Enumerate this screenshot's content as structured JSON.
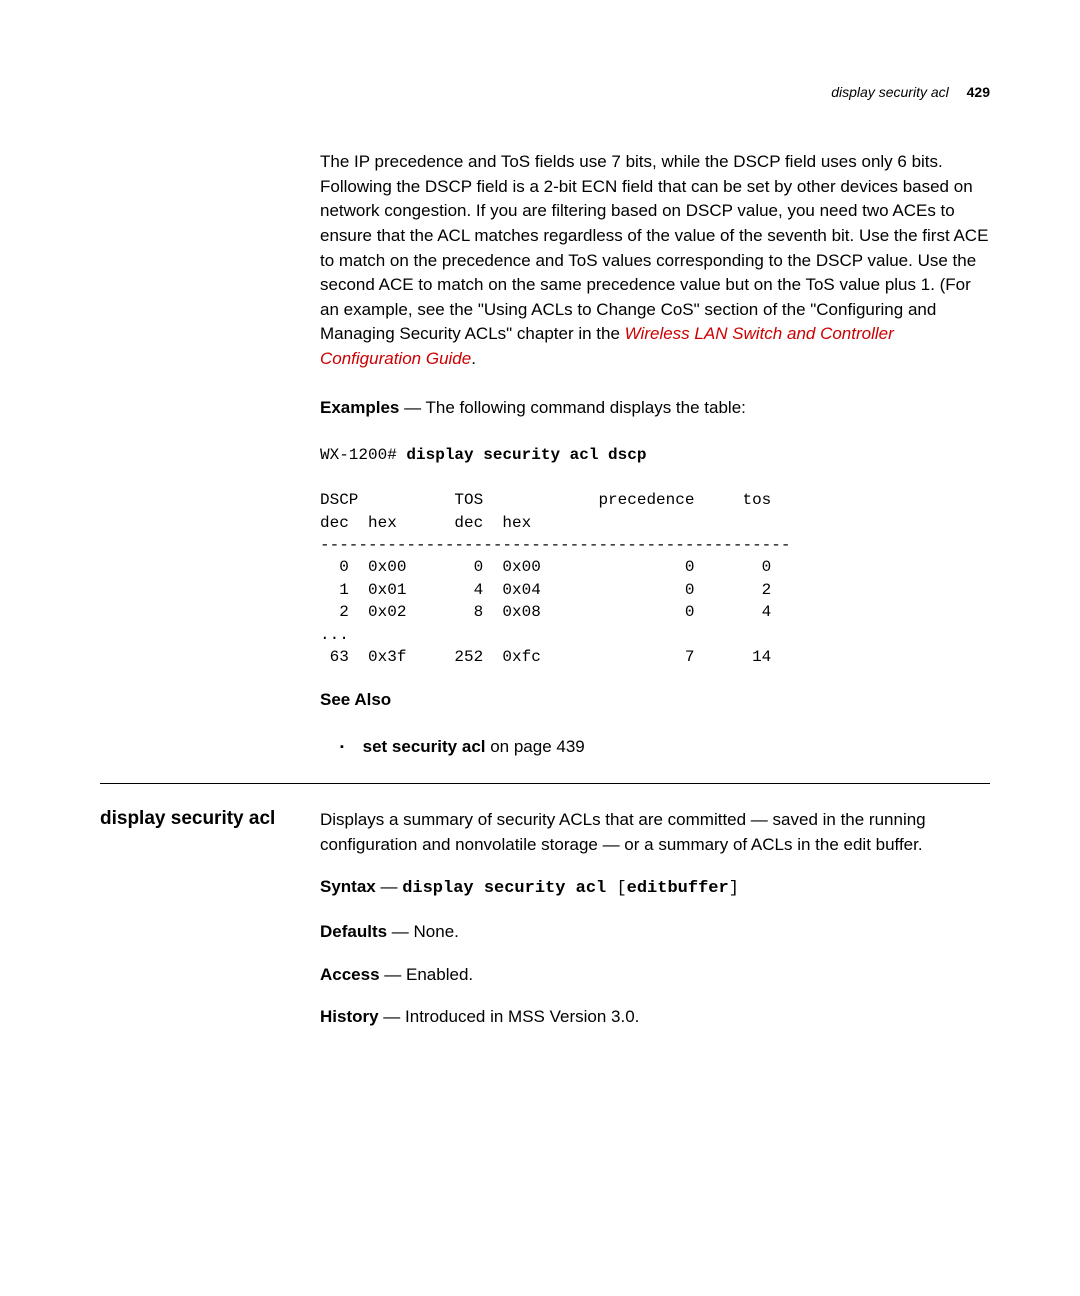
{
  "header": {
    "running_title": "display security acl",
    "page_number": "429"
  },
  "intro": {
    "paragraph": "The IP precedence and ToS fields use 7 bits, while the DSCP field uses only 6 bits. Following the DSCP field is a 2-bit ECN field that can be set by other devices based on network congestion. If you are filtering based on DSCP value, you need two ACEs to ensure that the ACL matches regardless of the value of the seventh bit. Use the first ACE to match on the precedence and ToS values corresponding to the DSCP value. Use the second ACE to match on the same precedence value but on the ToS value plus 1. (For an example, see the \"Using ACLs to Change CoS\" section of the \"Configuring and Managing Security ACLs\" chapter in the ",
    "link_text": "Wireless LAN Switch and Controller Configuration Guide",
    "period": "."
  },
  "examples": {
    "label": "Examples",
    "text": " — The following command displays the table:"
  },
  "console": {
    "prompt": "WX-1200# ",
    "command": "display security acl dscp",
    "table": "DSCP          TOS            precedence     tos\ndec  hex      dec  hex\n-------------------------------------------------\n  0  0x00       0  0x00               0       0 \n  1  0x01       4  0x04               0       2 \n  2  0x02       8  0x08               0       4 \n...\n 63  0x3f     252  0xfc               7      14 "
  },
  "see_also": {
    "heading": "See Also",
    "item_bold": "set security acl",
    "item_rest": " on page 439"
  },
  "section": {
    "title": "display security acl",
    "summary": "Displays a summary of security ACLs that are committed — saved in the running configuration and nonvolatile storage — or a summary of ACLs in the edit buffer.",
    "syntax_label": "Syntax",
    "syntax_dash": " — ",
    "syntax_cmd": "display security acl ",
    "syntax_optional": "editbuffer",
    "defaults_label": "Defaults",
    "defaults_text": " — None.",
    "access_label": "Access",
    "access_text": " — Enabled.",
    "history_label": "History",
    "history_text": " — Introduced in MSS Version 3.0."
  }
}
